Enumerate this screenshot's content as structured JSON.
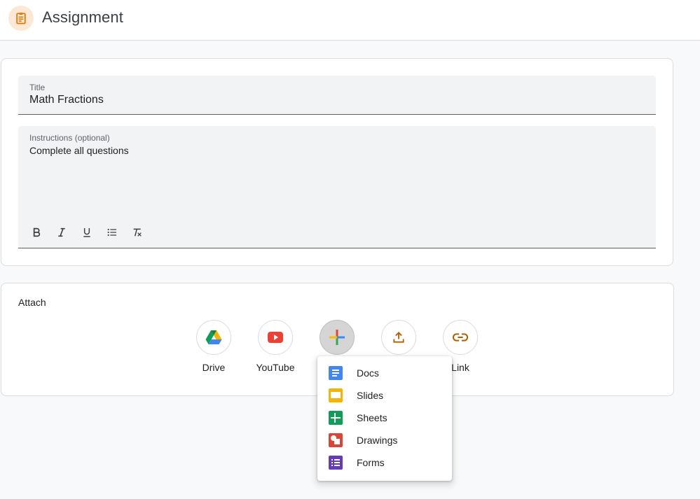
{
  "header": {
    "title": "Assignment",
    "icon": "assignment-icon",
    "accent": "#e37400"
  },
  "form": {
    "title": {
      "label": "Title",
      "value": "Math Fractions"
    },
    "instructions": {
      "label": "Instructions (optional)",
      "value": "Complete all questions"
    },
    "format_buttons": [
      "bold-icon",
      "italic-icon",
      "underline-icon",
      "bulleted-list-icon",
      "clear-formatting-icon"
    ]
  },
  "attach": {
    "label": "Attach",
    "items": [
      {
        "label": "Drive",
        "icon": "google-drive-icon"
      },
      {
        "label": "YouTube",
        "icon": "youtube-icon"
      },
      {
        "label": "",
        "icon": "create-plus-icon"
      },
      {
        "label": "",
        "icon": "upload-icon"
      },
      {
        "label": "Link",
        "icon": "link-icon"
      }
    ]
  },
  "create_menu": {
    "items": [
      {
        "label": "Docs",
        "icon": "docs-icon",
        "color": "#4285f4"
      },
      {
        "label": "Slides",
        "icon": "slides-icon",
        "color": "#f4b400"
      },
      {
        "label": "Sheets",
        "icon": "sheets-icon",
        "color": "#0f9d58"
      },
      {
        "label": "Drawings",
        "icon": "drawings-icon",
        "color": "#db4437"
      },
      {
        "label": "Forms",
        "icon": "forms-icon",
        "color": "#673ab7"
      }
    ]
  }
}
